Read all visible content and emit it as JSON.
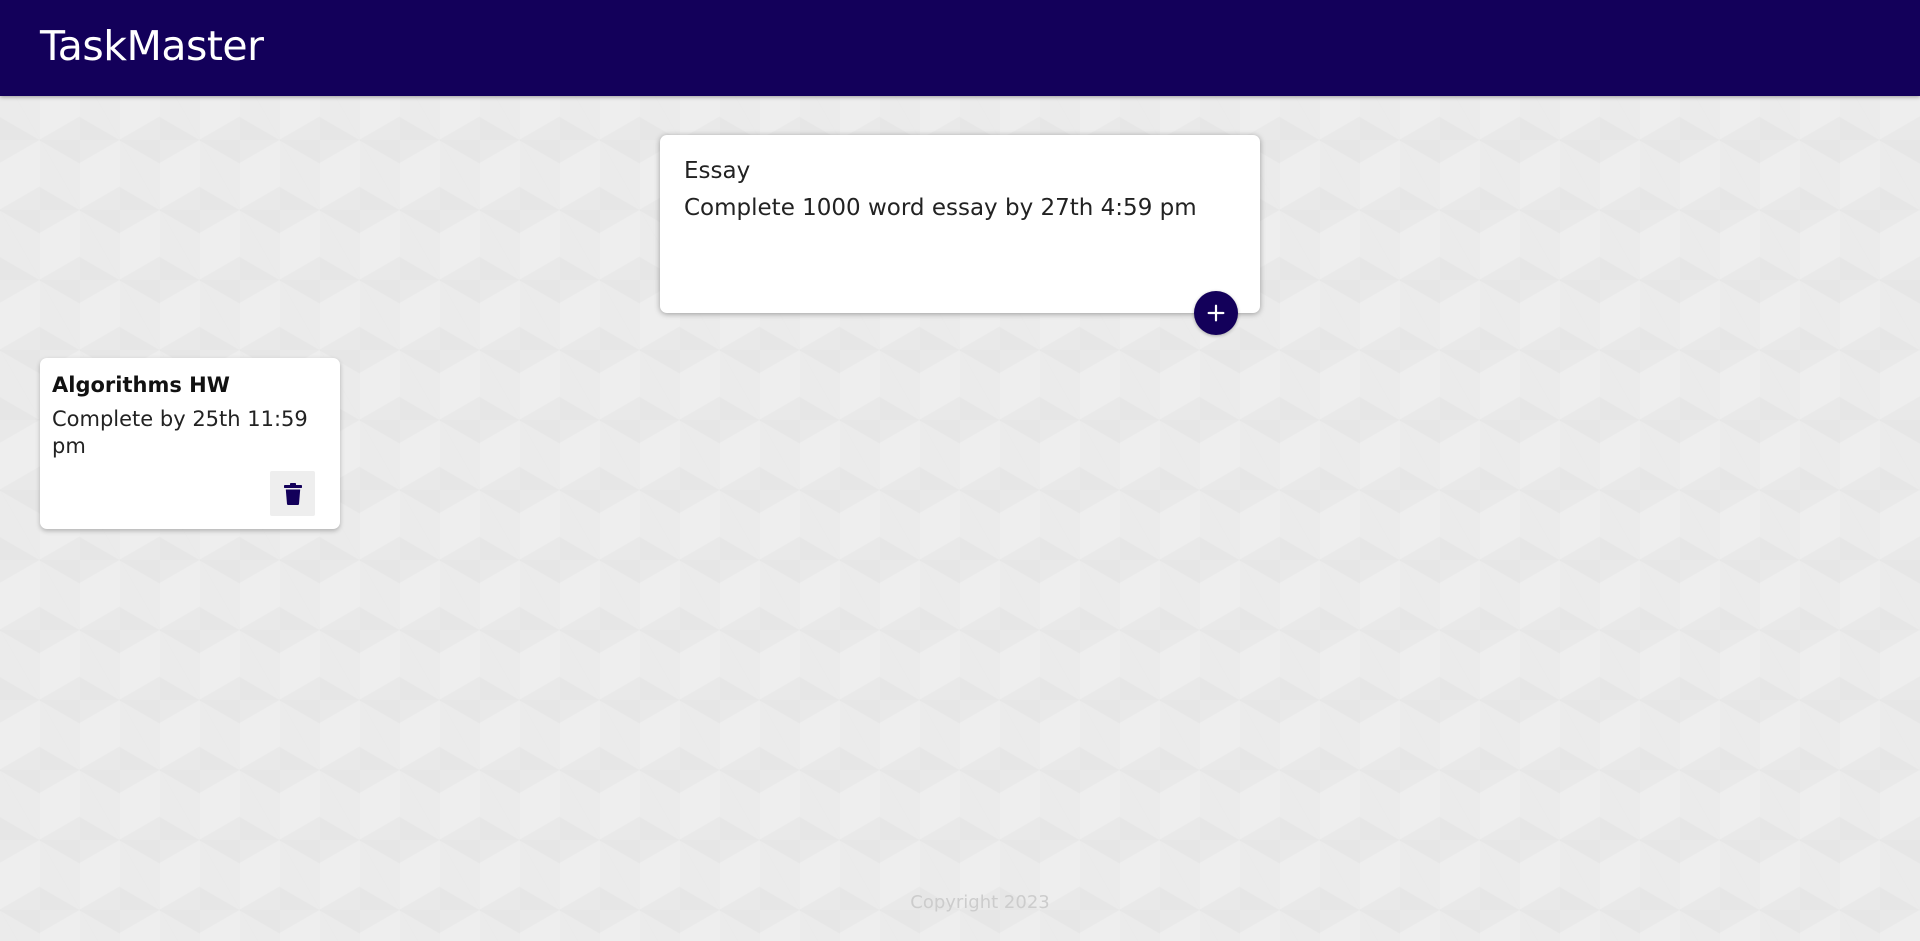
{
  "header": {
    "title": "TaskMaster"
  },
  "create_note": {
    "title_value": "Essay",
    "content_value": "Complete 1000 word essay by 27th 4:59 pm",
    "add_icon": "plus-icon"
  },
  "notes": [
    {
      "title": "Algorithms HW",
      "content": "Complete by 25th 11:59 pm",
      "delete_icon": "trash-icon"
    }
  ],
  "footer": {
    "text": "Copyright 2023"
  },
  "colors": {
    "header_bg": "#13005a",
    "accent": "#13005a",
    "background": "#eeeeee",
    "card_bg": "#ffffff",
    "footer_text": "#cccccc"
  }
}
